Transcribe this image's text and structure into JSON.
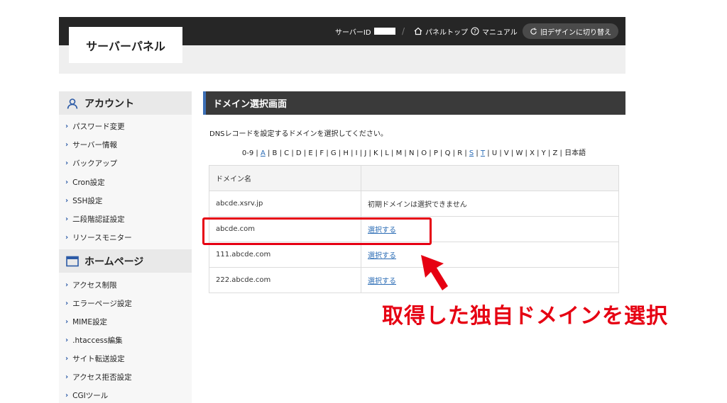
{
  "header": {
    "logo": "サーバーパネル",
    "server_id_label": "サーバーID",
    "separator": "/",
    "panel_top": "パネルトップ",
    "manual": "マニュアル",
    "old_design": "旧デザインに切り替え"
  },
  "sidebar": {
    "sections": [
      {
        "title": "アカウント",
        "icon": "user-icon",
        "items": [
          "パスワード変更",
          "サーバー情報",
          "バックアップ",
          "Cron設定",
          "SSH設定",
          "二段階認証設定",
          "リソースモニター"
        ]
      },
      {
        "title": "ホームページ",
        "icon": "window-icon",
        "items": [
          "アクセス制限",
          "エラーページ設定",
          "MIME設定",
          ".htaccess編集",
          "サイト転送設定",
          "アクセス拒否設定",
          "CGIツール"
        ]
      }
    ]
  },
  "main": {
    "title": "ドメイン選択画面",
    "instruction": "DNSレコードを設定するドメインを選択してください。",
    "alpha_index": [
      "0-9",
      "A",
      "B",
      "C",
      "D",
      "E",
      "F",
      "G",
      "H",
      "I",
      "J",
      "K",
      "L",
      "M",
      "N",
      "O",
      "P",
      "Q",
      "R",
      "S",
      "T",
      "U",
      "V",
      "W",
      "X",
      "Y",
      "Z",
      "日本語"
    ],
    "alpha_links": [
      "A",
      "S",
      "T"
    ],
    "table": {
      "header": "ドメイン名",
      "rows": [
        {
          "domain": "abcde.xsrv.jp",
          "action": "初期ドメインは選択できません",
          "link": false
        },
        {
          "domain": "abcde.com",
          "action": "選択する",
          "link": true
        },
        {
          "domain": "111.abcde.com",
          "action": "選択する",
          "link": true
        },
        {
          "domain": "222.abcde.com",
          "action": "選択する",
          "link": true
        }
      ]
    }
  },
  "annotation": "取得した独自ドメインを選択",
  "colors": {
    "accent": "#e60012",
    "link": "#2b6cb5",
    "header_bg": "#262626"
  }
}
